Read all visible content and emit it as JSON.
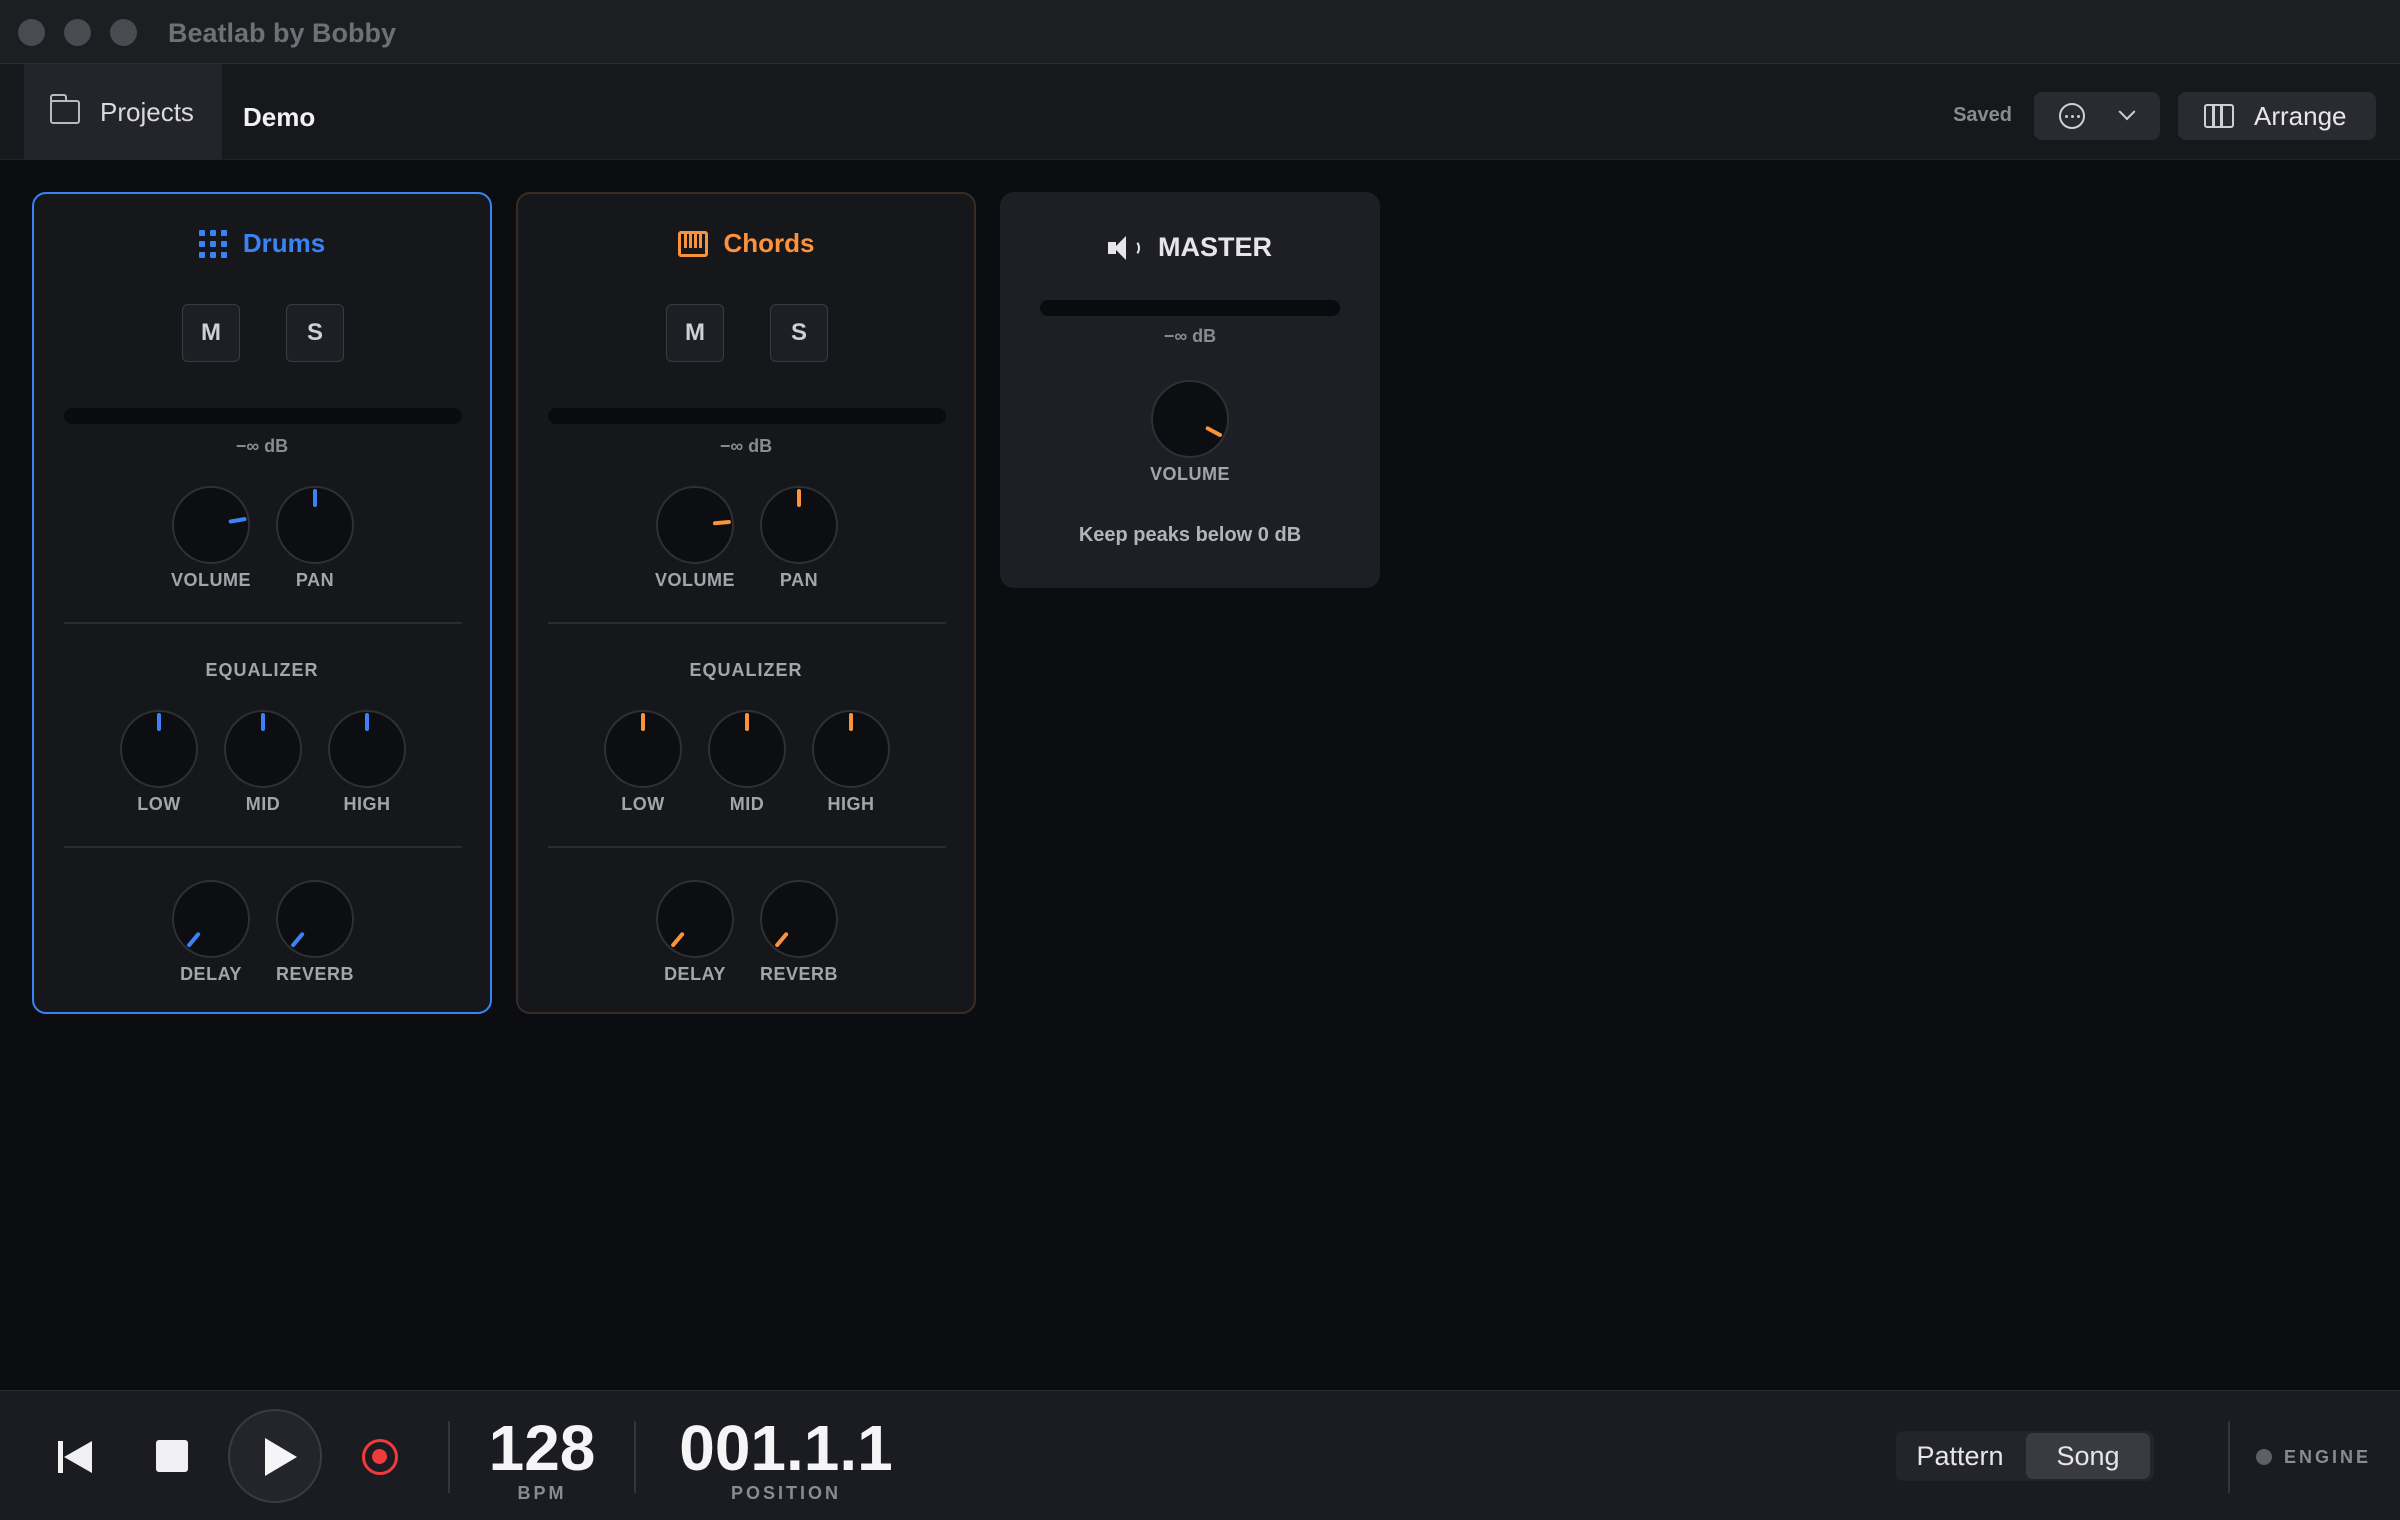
{
  "window": {
    "title": "Beatlab by Bobby"
  },
  "header": {
    "projects_label": "Projects",
    "project_name": "Demo",
    "status": "Saved",
    "arrange_label": "Arrange"
  },
  "channels": [
    {
      "name": "Drums",
      "accent": "#3b82f6",
      "icon": "grid-icon",
      "mute_label": "M",
      "solo_label": "S",
      "level": "−∞ dB",
      "volume_label": "VOLUME",
      "pan_label": "PAN",
      "eq_title": "EQUALIZER",
      "low_label": "LOW",
      "mid_label": "MID",
      "high_label": "HIGH",
      "delay_label": "DELAY",
      "reverb_label": "REVERB"
    },
    {
      "name": "Chords",
      "accent": "#fb923c",
      "icon": "piano-icon",
      "mute_label": "M",
      "solo_label": "S",
      "level": "−∞ dB",
      "volume_label": "VOLUME",
      "pan_label": "PAN",
      "eq_title": "EQUALIZER",
      "low_label": "LOW",
      "mid_label": "MID",
      "high_label": "HIGH",
      "delay_label": "DELAY",
      "reverb_label": "REVERB"
    }
  ],
  "master": {
    "name": "MASTER",
    "icon": "speaker-icon",
    "level": "−∞ dB",
    "volume_label": "VOLUME",
    "note": "Keep peaks below 0 dB"
  },
  "transport": {
    "bpm": "128",
    "bpm_label": "BPM",
    "position": "001.1.1",
    "position_label": "POSITION",
    "mode_pattern": "Pattern",
    "mode_song": "Song",
    "selected_mode": "Song",
    "engine_label": "ENGINE",
    "record_color": "#ef3b3b"
  }
}
